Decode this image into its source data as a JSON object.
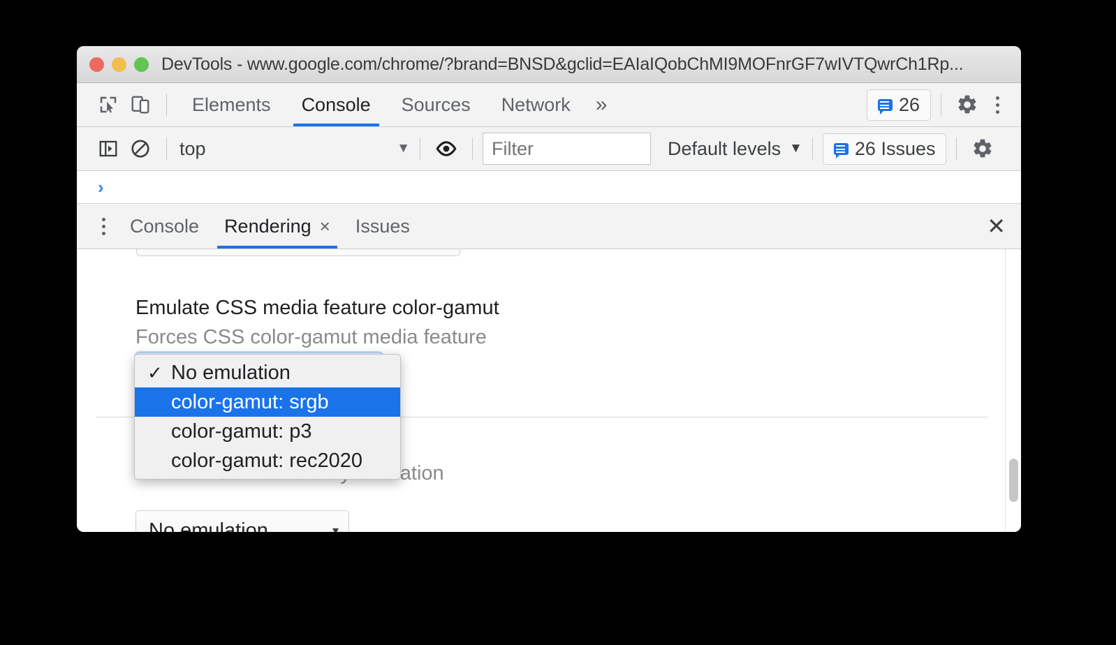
{
  "window": {
    "title": "DevTools - www.google.com/chrome/?brand=BNSD&gclid=EAIaIQobChMI9MOFnrGF7wIVTQwrCh1Rp...",
    "traffic_lights": [
      "close",
      "minimize",
      "maximize"
    ]
  },
  "main_toolbar": {
    "inspect_icon": "inspect-cursor-icon",
    "device_icon": "device-toolbar-icon",
    "tabs": [
      {
        "label": "Elements",
        "active": false
      },
      {
        "label": "Console",
        "active": true
      },
      {
        "label": "Sources",
        "active": false
      },
      {
        "label": "Network",
        "active": false
      }
    ],
    "more_tabs": "»",
    "issues_count": "26",
    "settings_icon": "gear-icon",
    "more_options_icon": "kebab-menu-icon"
  },
  "console_toolbar": {
    "sidebar_icon": "console-sidebar-icon",
    "clear_icon": "clear-console-icon",
    "context": "top",
    "context_caret": "▼",
    "eye_icon": "live-expression-icon",
    "filter_placeholder": "Filter",
    "levels_label": "Default levels",
    "levels_caret": "▼",
    "issues_label": "26 Issues",
    "settings_icon": "gear-icon"
  },
  "console_body": {
    "prompt": "›"
  },
  "drawer": {
    "menu_icon": "kebab-menu-icon",
    "tabs": [
      {
        "label": "Console",
        "active": false,
        "closable": false
      },
      {
        "label": "Rendering",
        "active": true,
        "closable": true,
        "close_glyph": "×"
      },
      {
        "label": "Issues",
        "active": false,
        "closable": false
      }
    ],
    "close_glyph": "✕"
  },
  "rendering": {
    "color_gamut": {
      "title": "Emulate CSS media feature color-gamut",
      "subtitle": "Forces CSS color-gamut media feature",
      "selected_value": "No emulation",
      "options": [
        {
          "label": "No emulation",
          "checked": true,
          "highlighted": false
        },
        {
          "label": "color-gamut: srgb",
          "checked": false,
          "highlighted": true
        },
        {
          "label": "color-gamut: p3",
          "checked": false,
          "highlighted": false
        },
        {
          "label": "color-gamut: rec2020",
          "checked": false,
          "highlighted": false
        }
      ],
      "check_glyph": "✓"
    },
    "vision_deficiency": {
      "subtitle": "Forces vision deficiency emulation",
      "selected_value": "No emulation",
      "caret": "▾"
    }
  },
  "colors": {
    "accent_blue": "#1a73e8",
    "highlight_blue": "#1a73e8",
    "prompt_blue": "#4285f4",
    "text_primary": "#202124",
    "text_secondary": "#5f6368",
    "text_muted": "#8a8a8a",
    "toolbar_bg": "#f3f3f3",
    "titlebar_bg": "#e0e0e0",
    "light_red": "#ec6a5f",
    "light_yellow": "#f4bd4f",
    "light_green": "#61c554"
  }
}
